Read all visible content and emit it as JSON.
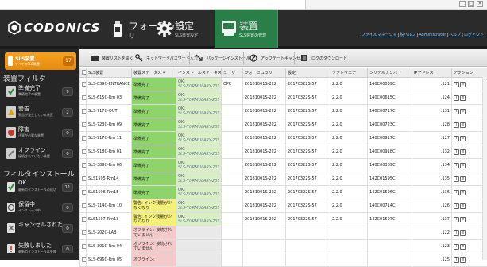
{
  "brand": "CODONICS",
  "nav": {
    "formula": {
      "label": "フォーミュラ",
      "sub": "リ"
    },
    "settings": {
      "label": "設定",
      "sub": "SLS装置設定"
    },
    "devices": {
      "label": "装置",
      "sub": "SLS装置の管理"
    }
  },
  "top_links": [
    "ファイルマネージャ",
    "脱ヘルプ",
    "Administrator",
    "ヘルプ",
    "ログアウト"
  ],
  "sidebar": {
    "selected": {
      "label": "SLS装置",
      "sub": "すべてのSLS装置",
      "count": "17"
    },
    "filter_title": "装置フィルタ",
    "filters": [
      {
        "label": "準備完了",
        "sub": "準備完了の装置",
        "count": "9"
      },
      {
        "label": "警告",
        "sub": "警告が発生している装置",
        "count": "2"
      },
      {
        "label": "障害",
        "sub": "注意が必要な装置",
        "count": "0"
      },
      {
        "label": "オフライン",
        "sub": "接続されていない装置",
        "count": "6"
      }
    ],
    "install_title": "フィルタインストール",
    "installs": [
      {
        "label": "OK",
        "sub": "最新のインストールの成功",
        "count": "11"
      },
      {
        "label": "保留中",
        "sub": "インストール中",
        "count": "0"
      },
      {
        "label": "キャンセルされた",
        "sub": "",
        "count": "0"
      },
      {
        "label": "失敗しました",
        "sub": "最新のインストールは失敗",
        "count": "0"
      }
    ]
  },
  "toolbar": {
    "open_list": "装置リストを開く",
    "network_pw": "ネットワークパスワード入力",
    "package_install": "パッケージインストール",
    "cancel_update": "アップデートキャンセル",
    "download_log": "ログのダウンロード"
  },
  "table": {
    "columns": [
      "SLS装置",
      "装置ステータス ▼",
      "インストールステータス",
      "ユーザー",
      "フォーミュラリ",
      "設定",
      "ソフトウエア",
      "シリアルナンバー",
      "IPアドレス",
      "アクション"
    ],
    "rows": [
      {
        "device": "SLS-039C-ENTRANCE",
        "status": "準備完了",
        "status_type": "ok",
        "install1": "OK:",
        "install2": "SLS-FORMULARY-201",
        "user": "OPE",
        "formulary": "20181001S-222",
        "settings": "20170322S-57",
        "software": "2.2.0",
        "serial": "140C00039C",
        "ip": ".121"
      },
      {
        "device": "SLS-615C-Rm 03",
        "status": "準備完了",
        "status_type": "ok",
        "install1": "OK:",
        "install2": "SLS-FORMULARY-201",
        "user": "",
        "formulary": "20181001S-222",
        "settings": "20170322S-57",
        "software": "2.2.0",
        "serial": "140C00615C",
        "ip": ".124"
      },
      {
        "device": "SLS-717C-OUT",
        "status": "準備完了",
        "status_type": "ok",
        "install1": "OK:",
        "install2": "SLS-FORMULARY-201",
        "user": "",
        "formulary": "20181001S-222",
        "settings": "20170322S-57",
        "software": "2.2.0",
        "serial": "140C00717C",
        "ip": ".131"
      },
      {
        "device": "SLS-723C-Rm 09",
        "status": "準備完了",
        "status_type": "ok",
        "install1": "OK:",
        "install2": "SLS-FORMULARY-201",
        "user": "",
        "formulary": "20181001S-222",
        "settings": "20170322S-57",
        "software": "2.2.0",
        "serial": "140C00723C",
        "ip": ".128"
      },
      {
        "device": "SLS-917C-Rm 11",
        "status": "準備完了",
        "status_type": "ok",
        "install1": "OK:",
        "install2": "SLS-FORMULARY-201",
        "user": "",
        "formulary": "20181001S-222",
        "settings": "20170322S-57",
        "software": "2.2.0",
        "serial": "140C00917C",
        "ip": ".127"
      },
      {
        "device": "SLS-918C-Rm 01",
        "status": "準備完了",
        "status_type": "ok",
        "install1": "OK:",
        "install2": "SLS-FORMULARY-201",
        "user": "",
        "formulary": "20181001S-222",
        "settings": "20170322S-57",
        "software": "2.2.0",
        "serial": "140C00918C",
        "ip": ".132"
      },
      {
        "device": "SLS-389C-Rm 06",
        "status": "準備完了",
        "status_type": "ok",
        "install1": "OK:",
        "install2": "SLS-FORMULARY-201",
        "user": "",
        "formulary": "20181001S-222",
        "settings": "20170322S-57",
        "software": "2.2.0",
        "serial": "140C00389C",
        "ip": ".134"
      },
      {
        "device": "SLS1595-Rm14",
        "status": "準備完了",
        "status_type": "ok",
        "install1": "OK:",
        "install2": "SLS-FORMULARY-201",
        "user": "",
        "formulary": "20181001S-222",
        "settings": "20170322S-57",
        "software": "2.2.0",
        "serial": "142C01595C",
        "ip": ".135"
      },
      {
        "device": "SLS1596-Rm15",
        "status": "準備完了",
        "status_type": "ok",
        "install1": "OK:",
        "install2": "SLS-FORMULARY-201",
        "user": "",
        "formulary": "20181001S-222",
        "settings": "20170322S-57",
        "software": "2.2.0",
        "serial": "142C01596C",
        "ip": ".136"
      },
      {
        "device": "SLS-714C-Rm 10",
        "status": "警告: インク残量が少なくなり",
        "status_type": "warn",
        "install1": "OK:",
        "install2": "SLS-FORMULARY-201",
        "user": "",
        "formulary": "20181001S-222",
        "settings": "20170322S-57",
        "software": "2.2.0",
        "serial": "140C00714C",
        "ip": ".126"
      },
      {
        "device": "SLS1597-Rm13",
        "status": "警告: インク残量が少なくなり",
        "status_type": "warn",
        "install1": "OK:",
        "install2": "SLS-FORMULARY-201",
        "user": "",
        "formulary": "20181001S-222",
        "settings": "20170322S-57",
        "software": "2.2.0",
        "serial": "142C01597C",
        "ip": ".137"
      },
      {
        "device": "SLS-202C-LAB",
        "status": "オフライン: 接続されていません",
        "status_type": "off",
        "install1": "",
        "install2": "",
        "user": "",
        "formulary": "",
        "settings": "",
        "software": "",
        "serial": "",
        "ip": ".122"
      },
      {
        "device": "SLS-391C-Rm 04",
        "status": "オフライン: 接続されていません",
        "status_type": "off",
        "install1": "",
        "install2": "",
        "user": "",
        "formulary": "",
        "settings": "",
        "software": "",
        "serial": "",
        "ip": ".123"
      },
      {
        "device": "SLS-696C-Rm 05",
        "status": "オフライン:",
        "status_type": "off",
        "install1": "",
        "install2": "",
        "user": "",
        "formulary": "",
        "settings": "",
        "software": "",
        "serial": "",
        "ip": ".125"
      }
    ]
  }
}
